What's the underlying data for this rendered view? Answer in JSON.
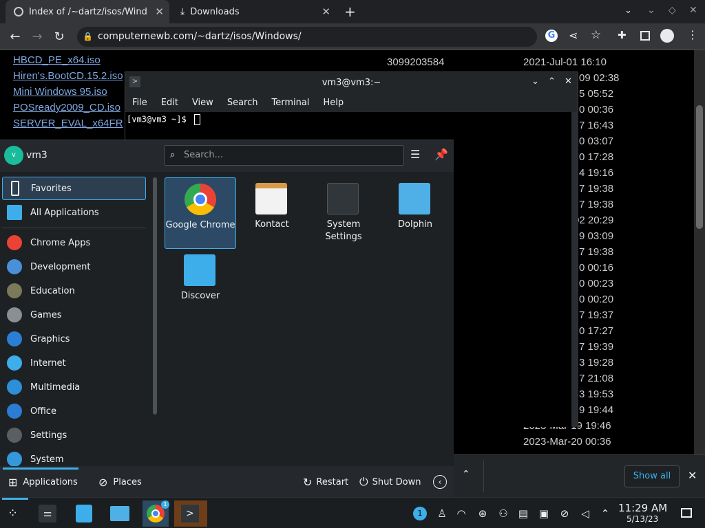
{
  "browser": {
    "tabs": [
      {
        "title": "Index of /~dartz/isos/Windows",
        "active": true
      },
      {
        "title": "Downloads",
        "active": false
      }
    ],
    "url": "computernewb.com/~dartz/isos/Windows/"
  },
  "listing": {
    "rows": [
      {
        "name": "HBCD_PE_x64.iso",
        "size": "3099203584",
        "date": "2021-Jul-01 16:10"
      },
      {
        "name": "Hiren's.BootCD.15.2.iso",
        "date": "09 02:38"
      },
      {
        "name": "Mini Windows 95.iso",
        "date": "5 05:52"
      },
      {
        "name": "POSready2009_CD.iso",
        "date": "0 00:36"
      },
      {
        "name": "SERVER_EVAL_x64FR",
        "date": "7 16:43"
      }
    ],
    "dates_right": [
      "0 03:07",
      "0 17:28",
      "4 19:16",
      "7 19:38",
      "7 19:38",
      "02 20:29",
      "9 03:09",
      "7 19:38",
      "0 00:16",
      "0 00:23",
      "0 00:20",
      "7 19:37",
      "0 17:27",
      "7 19:39",
      "3 19:28",
      "7 21:08",
      "3 19:53",
      "9 19:44",
      "2023-Mar-19 19:46",
      "2023-Mar-20 00:36"
    ]
  },
  "konsole": {
    "title": "vm3@vm3:~",
    "menu": [
      "File",
      "Edit",
      "View",
      "Search",
      "Terminal",
      "Help"
    ],
    "prompt": "[vm3@vm3 ~]$"
  },
  "launcher": {
    "user": "vm3",
    "avatar_letter": "v",
    "search_placeholder": "Search...",
    "categories": [
      {
        "label": "Favorites",
        "icon": "bookmark-icon",
        "color": "#eff0f1"
      },
      {
        "label": "All Applications",
        "icon": "grid-icon",
        "color": "#3daee9"
      },
      {
        "label": "Chrome Apps",
        "icon": "chrome-icon",
        "color": "#ea4335"
      },
      {
        "label": "Development",
        "icon": "development-icon",
        "color": "#4a90d9"
      },
      {
        "label": "Education",
        "icon": "education-icon",
        "color": "#7a7a5a"
      },
      {
        "label": "Games",
        "icon": "gamepad-icon",
        "color": "#8a8f94"
      },
      {
        "label": "Graphics",
        "icon": "graphics-icon",
        "color": "#2a7fd4"
      },
      {
        "label": "Internet",
        "icon": "globe-icon",
        "color": "#3daee9"
      },
      {
        "label": "Multimedia",
        "icon": "multimedia-icon",
        "color": "#2d8fd8"
      },
      {
        "label": "Office",
        "icon": "office-icon",
        "color": "#2b7cd3"
      },
      {
        "label": "Settings",
        "icon": "settings-icon",
        "color": "#5a5f64"
      },
      {
        "label": "System",
        "icon": "system-icon",
        "color": "#3598db"
      }
    ],
    "apps": [
      {
        "label": "Google Chrome",
        "icon": "chrome-icon"
      },
      {
        "label": "Kontact",
        "icon": "kontact-icon"
      },
      {
        "label": "System Settings",
        "icon": "system-settings-icon"
      },
      {
        "label": "Dolphin",
        "icon": "folder-icon"
      },
      {
        "label": "Discover",
        "icon": "discover-icon"
      }
    ],
    "footer": {
      "applications": "Applications",
      "places": "Places",
      "restart": "Restart",
      "shutdown": "Shut Down"
    }
  },
  "notifications": {
    "show_all": "Show all"
  },
  "taskbar": {
    "time": "11:29 AM",
    "date": "5/13/23",
    "badge": "1"
  }
}
